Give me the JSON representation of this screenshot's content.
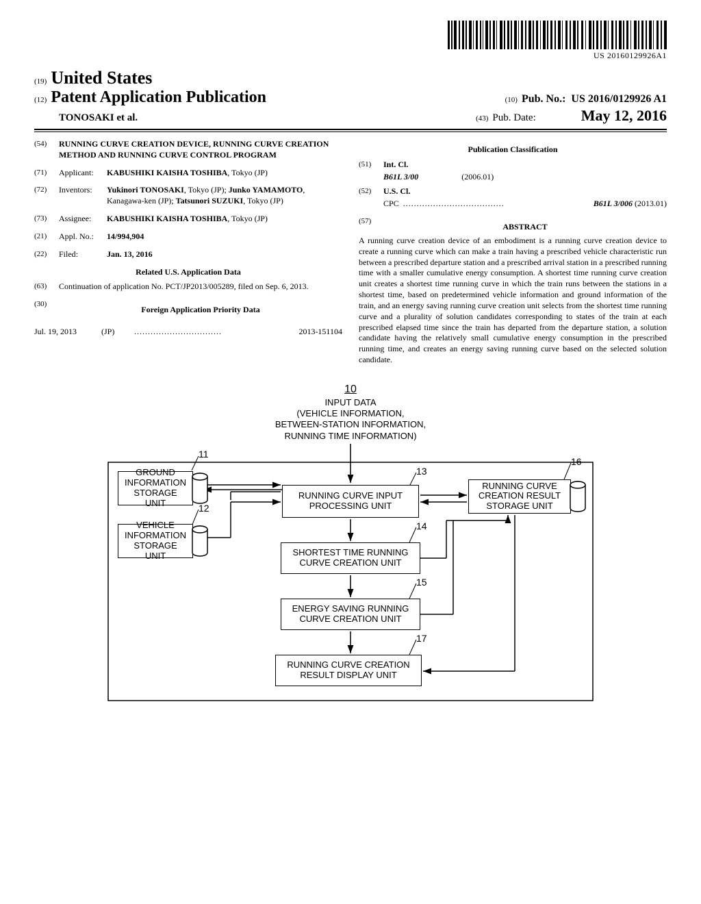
{
  "barcode_number": "US 20160129926A1",
  "header": {
    "sup19": "(19)",
    "country": "United States",
    "sup12": "(12)",
    "pub_type": "Patent Application Publication",
    "authors_line": "TONOSAKI et al.",
    "sup10": "(10)",
    "pubno_label": "Pub. No.:",
    "pubno": "US 2016/0129926 A1",
    "sup43": "(43)",
    "pubdate_label": "Pub. Date:",
    "pubdate": "May 12, 2016"
  },
  "left": {
    "f54_code": "(54)",
    "f54_val": "RUNNING CURVE CREATION DEVICE, RUNNING CURVE CREATION METHOD AND RUNNING CURVE CONTROL PROGRAM",
    "f71_code": "(71)",
    "f71_label": "Applicant:",
    "f71_val": "KABUSHIKI KAISHA TOSHIBA",
    "f71_loc": ", Tokyo (JP)",
    "f72_code": "(72)",
    "f72_label": "Inventors:",
    "f72_val1_name": "Yukinori TONOSAKI",
    "f72_val1_loc": ", Tokyo (JP); ",
    "f72_val2_name": "Junko YAMAMOTO",
    "f72_val2_loc": ", Kanagawa-ken (JP); ",
    "f72_val3_name": "Tatsunori SUZUKI",
    "f72_val3_loc": ", Tokyo (JP)",
    "f73_code": "(73)",
    "f73_label": "Assignee:",
    "f73_val": "KABUSHIKI KAISHA TOSHIBA",
    "f73_loc": ", Tokyo (JP)",
    "f21_code": "(21)",
    "f21_label": "Appl. No.:",
    "f21_val": "14/994,904",
    "f22_code": "(22)",
    "f22_label": "Filed:",
    "f22_val": "Jan. 13, 2016",
    "related_hd": "Related U.S. Application Data",
    "f63_code": "(63)",
    "f63_val": "Continuation of application No. PCT/JP2013/005289, filed on Sep. 6, 2013.",
    "f30_code": "(30)",
    "f30_hd": "Foreign Application Priority Data",
    "prio_date": "Jul. 19, 2013",
    "prio_cc": "(JP)",
    "prio_num": "2013-151104"
  },
  "right": {
    "pubclass_hd": "Publication Classification",
    "f51_code": "(51)",
    "f51_label": "Int. Cl.",
    "f51_sym": "B61L 3/00",
    "f51_ver": "(2006.01)",
    "f52_code": "(52)",
    "f52_label": "U.S. Cl.",
    "f52_cpc_lbl": "CPC",
    "f52_cpc_val": "B61L 3/006",
    "f52_cpc_ver": " (2013.01)",
    "f57_code": "(57)",
    "abstract_hd": "ABSTRACT",
    "abstract": "A running curve creation device of an embodiment is a running curve creation device to create a running curve which can make a train having a prescribed vehicle characteristic run between a prescribed departure station and a prescribed arrival station in a prescribed running time with a smaller cumulative energy consumption. A shortest time running curve creation unit creates a shortest time running curve in which the train runs between the stations in a shortest time, based on predetermined vehicle information and ground information of the train, and an energy saving running curve creation unit selects from the shortest time running curve and a plurality of solution candidates corresponding to states of the train at each prescribed elapsed time since the train has departed from the departure station, a solution candidate having the relatively small cumulative energy consumption in the prescribed running time, and creates an energy saving running curve based on the selected solution candidate."
  },
  "figure": {
    "ref10": "10",
    "input_data_l1": "INPUT DATA",
    "input_data_l2": "(VEHICLE INFORMATION,",
    "input_data_l3": "BETWEEN-STATION INFORMATION,",
    "input_data_l4": "RUNNING TIME INFORMATION)",
    "ref11": "11",
    "box11": "GROUND INFORMATION STORAGE UNIT",
    "ref12": "12",
    "box12": "VEHICLE INFORMATION STORAGE UNIT",
    "ref13": "13",
    "box13": "RUNNING CURVE INPUT PROCESSING UNIT",
    "ref14": "14",
    "box14": "SHORTEST TIME RUNNING CURVE CREATION UNIT",
    "ref15": "15",
    "box15": "ENERGY SAVING RUNNING CURVE CREATION UNIT",
    "ref16": "16",
    "box16": "RUNNING CURVE CREATION RESULT STORAGE UNIT",
    "ref17": "17",
    "box17": "RUNNING CURVE CREATION RESULT DISPLAY UNIT"
  }
}
